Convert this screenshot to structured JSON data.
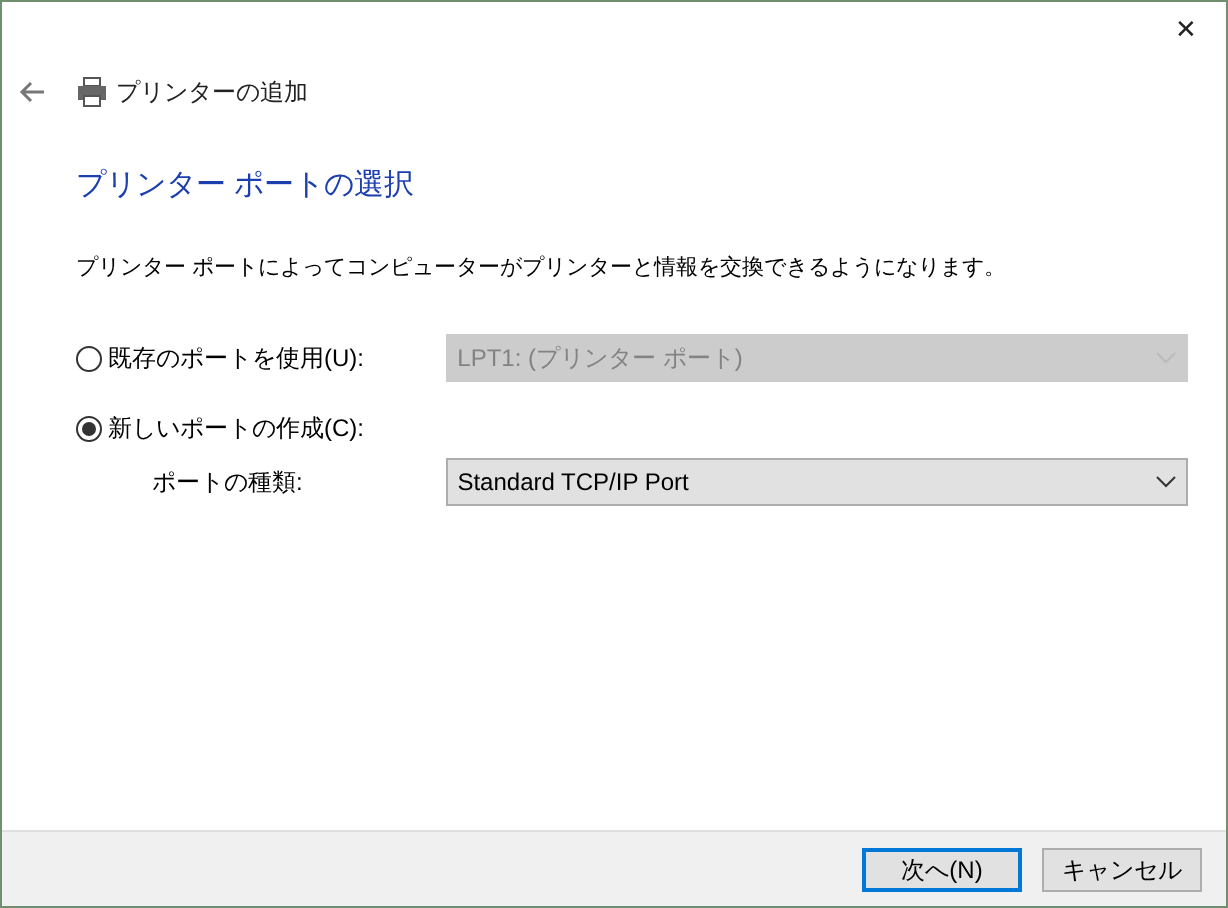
{
  "window": {
    "close": "✕"
  },
  "header": {
    "title": "プリンターの追加"
  },
  "heading": "プリンター ポートの選択",
  "description": "プリンター ポートによってコンピューターがプリンターと情報を交換できるようになります。",
  "options": [
    {
      "label": "既存のポートを使用(U):",
      "selected": false,
      "dropdown": {
        "value": "LPT1: (プリンター ポート)",
        "disabled": true
      }
    },
    {
      "label": "新しいポートの作成(C):",
      "selected": true,
      "sub": {
        "label": "ポートの種類:",
        "dropdown": {
          "value": "Standard TCP/IP Port",
          "disabled": false
        }
      }
    }
  ],
  "buttons": [
    {
      "label": "次へ(N)",
      "default": true
    },
    {
      "label": "キャンセル",
      "default": false
    }
  ]
}
